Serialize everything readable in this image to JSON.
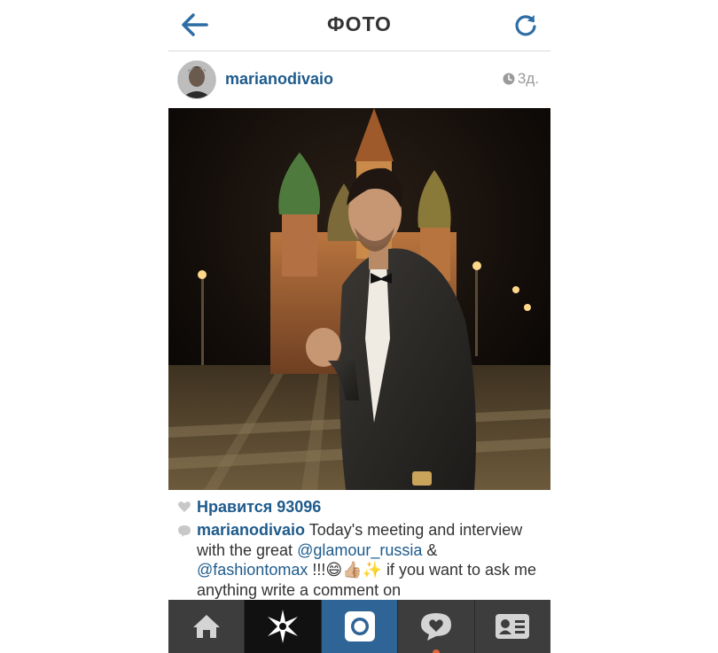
{
  "header": {
    "title": "ФОТО",
    "back_icon": "back-arrow-icon",
    "refresh_icon": "refresh-icon",
    "accent_color": "#1e5b8c"
  },
  "post": {
    "username": "marianodivaio",
    "time": "3д.",
    "likes": "Нравится 93096",
    "caption": {
      "username": "marianodivaio",
      "text_1": " Today's meeting and interview with the great ",
      "mention_1": "@glamour_russia",
      "text_2": " & ",
      "mention_2": "@fashiontomax",
      "text_3": " !!!😄👍🏼✨ if you want to ask me anything write a comment on"
    }
  },
  "tabbar": {
    "tabs": [
      {
        "icon": "home-icon"
      },
      {
        "icon": "explore-star-icon"
      },
      {
        "icon": "camera-icon"
      },
      {
        "icon": "activity-heart-icon"
      },
      {
        "icon": "profile-card-icon"
      }
    ]
  }
}
